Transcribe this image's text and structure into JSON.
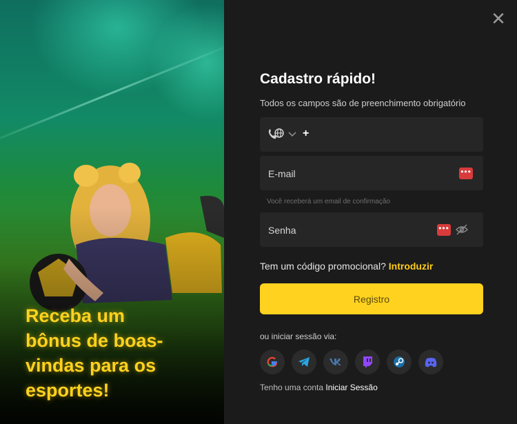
{
  "close_label": "✕",
  "promo": {
    "lines": [
      "Receba um",
      "bônus de boas-",
      "vindas para os",
      "esportes!"
    ]
  },
  "form": {
    "title": "Cadastro rápido!",
    "subtitle": "Todos os campos são de preenchimento obrigatório",
    "phone": {
      "prefix": "+",
      "value": ""
    },
    "email": {
      "placeholder": "E-mail",
      "hint": "Você receberá um email de confirmação"
    },
    "password": {
      "placeholder": "Senha"
    },
    "promo_code": {
      "question": "Tem um código promocional?",
      "link": "Introduzir"
    },
    "submit_label": "Registro",
    "social_label": "ou iniciar sessão via:",
    "social": [
      "google-icon",
      "telegram-icon",
      "vk-icon",
      "twitch-icon",
      "steam-icon",
      "discord-icon"
    ],
    "account": {
      "text": "Tenho uma conta",
      "link": "Iniciar Sessão"
    }
  },
  "colors": {
    "accent": "#ffd21f",
    "background": "#1b1b1b",
    "field": "#262626",
    "badge_red": "#d83b3b"
  }
}
